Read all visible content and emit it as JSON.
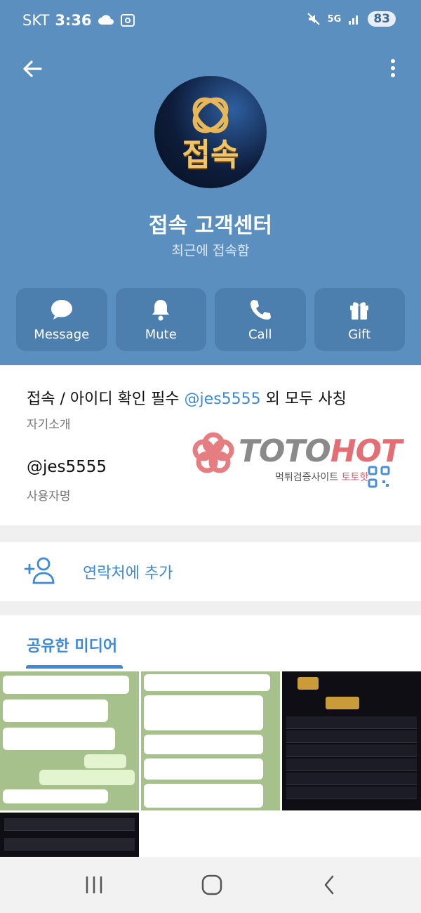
{
  "status_bar": {
    "carrier": "SKT",
    "time": "3:36",
    "network": "5G",
    "battery": "83"
  },
  "profile": {
    "avatar_text": "접속",
    "name": "접속 고객센터",
    "status": "최근에 접속함"
  },
  "actions": [
    {
      "label": "Message",
      "icon": "message-icon"
    },
    {
      "label": "Mute",
      "icon": "bell-icon"
    },
    {
      "label": "Call",
      "icon": "phone-icon"
    },
    {
      "label": "Gift",
      "icon": "gift-icon"
    }
  ],
  "info": {
    "bio_before": "접속 / 아이디 확인 필수 ",
    "bio_mention": "@jes5555",
    "bio_after": " 외 모두 사칭",
    "bio_label": "자기소개",
    "username": "@jes5555",
    "username_label": "사용자명"
  },
  "watermark": {
    "brand_main": "TOTO",
    "brand_accent": "HOT",
    "sub_main": "먹튀검증사이트 ",
    "sub_accent": "토토핫"
  },
  "add_contact": {
    "label": "연락처에 추가"
  },
  "media": {
    "title": "공유한 미디어"
  },
  "colors": {
    "header": "#5b8fbf",
    "accent": "#3e8ad6",
    "action_button": "#4d7fae"
  }
}
